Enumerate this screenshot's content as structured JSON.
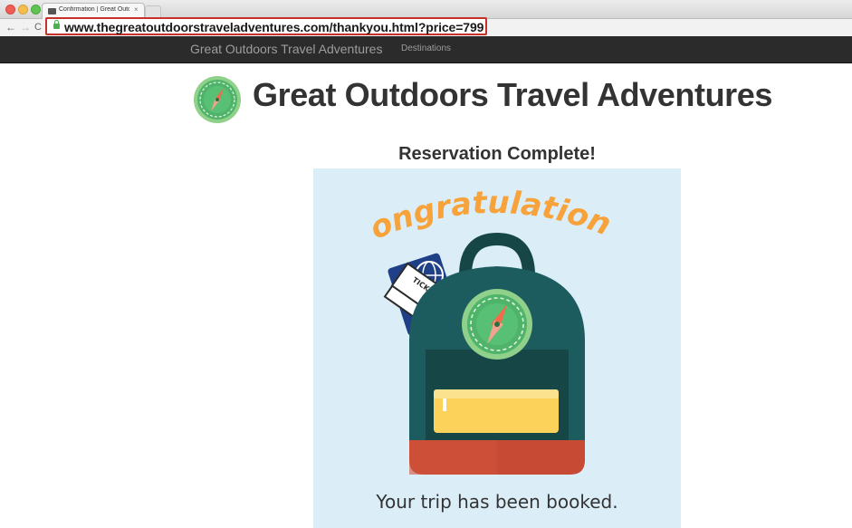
{
  "browser": {
    "tab_title": "Confirmation | Great Outd",
    "tab_close": "×",
    "url": "www.thegreatoutdoorstraveladventures.com/thankyou.html?price=799",
    "back": "←",
    "forward": "→",
    "reload": "C"
  },
  "nav": {
    "brand": "Great Outdoors Travel Adventures",
    "destinations": "Destinations"
  },
  "page": {
    "title": "Great Outdoors Travel Adventures",
    "reservation_heading": "Reservation Complete!"
  },
  "hero": {
    "congrats": "Congratulations!",
    "ticket_label": "TICKET",
    "caption": "Your trip has been booked."
  },
  "colors": {
    "hero_bg": "#dbeef8",
    "backpack_teal": "#1d5c5e",
    "backpack_dark": "#174647",
    "pocket_yellow": "#fdd25a",
    "bottom_red": "#c64a34",
    "congrats_orange": "#f7a23a",
    "compass_green": "#4fb46a",
    "url_highlight": "#c8312a"
  }
}
